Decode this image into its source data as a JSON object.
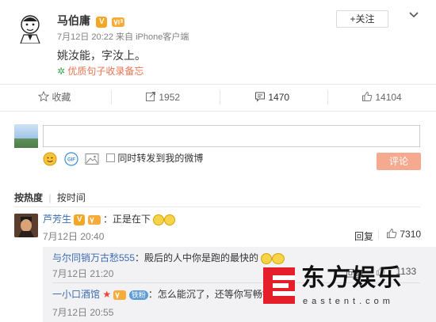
{
  "post": {
    "author": "马伯庸",
    "verified_badge": "V",
    "vip_badge": "VIP",
    "timestamp": "7月12日 20:22 来自",
    "source": "iPhone客户端",
    "text": "姚汝能，字汝上。",
    "tag": "优质句子收录备忘",
    "follow_label": "+关注",
    "menu_icon": "chevron-down-icon"
  },
  "actions": {
    "favorite_label": "收藏",
    "repost_count": "1952",
    "comment_count": "1470",
    "like_count": "14104"
  },
  "composer": {
    "input_value": "",
    "checkbox_label": "同时转发到我的微博",
    "submit_label": "评论"
  },
  "sort": {
    "by_hot": "按热度",
    "by_time": "按时间"
  },
  "comments": [
    {
      "author": "芦芳生",
      "text": "：正是在下",
      "time": "7月12日 20:40",
      "reply_label": "回复",
      "likes": "7310",
      "replies": [
        {
          "author": "与尔同销万古愁555",
          "text": "：殿后的人中你是跑的最快的",
          "time": "7月12日 21:20",
          "reply_label": "回复",
          "likes": "1133"
        },
        {
          "author": "一小口酒馆",
          "fan_badge": "铁粉",
          "text": "：怎么能沉了，还等你写畅销传",
          "time": "7月12日 20:55"
        }
      ]
    }
  ],
  "watermark": {
    "logo_letter": "E",
    "brand": "东方娱乐",
    "url": "eastent.com"
  },
  "colors": {
    "link": "#eb7350",
    "blue_link": "#3b6bb3",
    "submit": "#f5a98e",
    "badge": "#f5a623",
    "watermark_red": "#e41f2a"
  }
}
